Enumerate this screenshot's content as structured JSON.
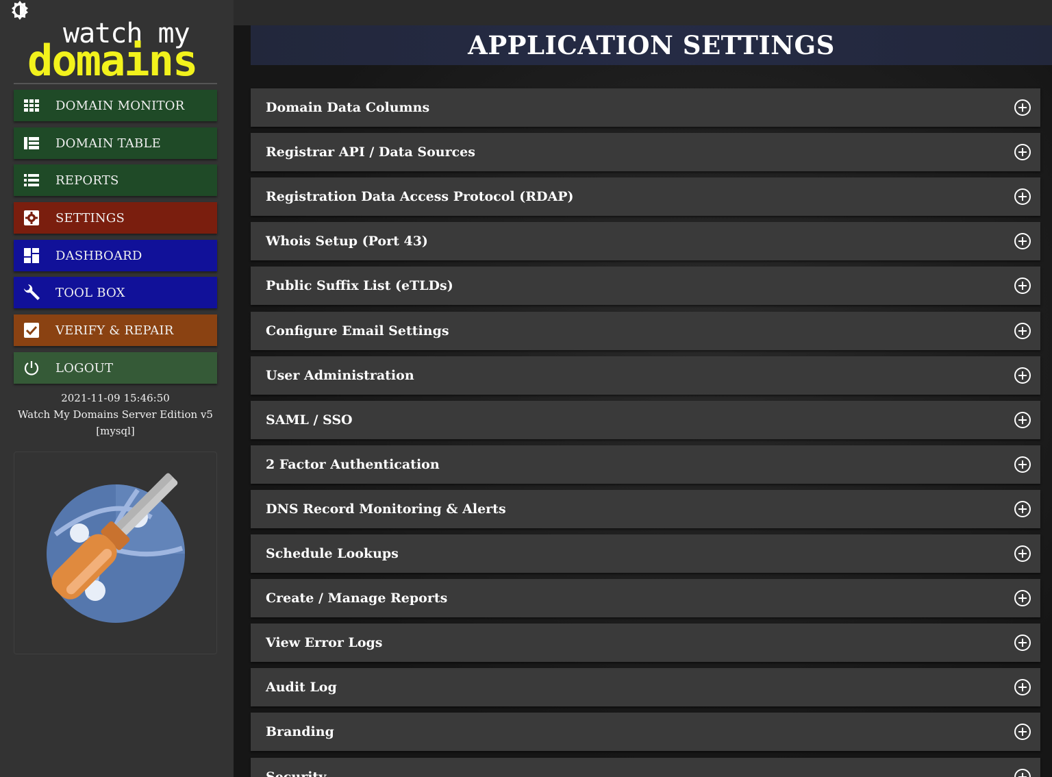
{
  "app": {
    "logo_top": "watch my",
    "logo_bottom": "domains",
    "theme_toggle_icon": "brightness-icon"
  },
  "sidebar": {
    "items": [
      {
        "label": "DOMAIN MONITOR",
        "icon": "grid-icon",
        "color": "#1f4a27"
      },
      {
        "label": "DOMAIN TABLE",
        "icon": "table-icon",
        "color": "#1f4a27"
      },
      {
        "label": "REPORTS",
        "icon": "list-icon",
        "color": "#1f4a27"
      },
      {
        "label": "SETTINGS",
        "icon": "gear-icon",
        "color": "#7a1e0e",
        "active": true
      },
      {
        "label": "DASHBOARD",
        "icon": "dashboard-icon",
        "color": "#111199"
      },
      {
        "label": "TOOL BOX",
        "icon": "wrench-icon",
        "color": "#111199"
      },
      {
        "label": "VERIFY & REPAIR",
        "icon": "checkbox-icon",
        "color": "#8a4212"
      },
      {
        "label": "LOGOUT",
        "icon": "power-icon",
        "color": "#355a37"
      }
    ],
    "info": {
      "datetime": "2021-11-09 15:46:50",
      "edition": "Watch My Domains Server Edition v5",
      "db": "[mysql]"
    }
  },
  "main": {
    "title": "APPLICATION SETTINGS",
    "panels": [
      {
        "label": "Domain Data Columns"
      },
      {
        "label": "Registrar API / Data Sources"
      },
      {
        "label": "Registration Data Access Protocol (RDAP)"
      },
      {
        "label": "Whois Setup (Port 43)"
      },
      {
        "label": "Public Suffix List (eTLDs)"
      },
      {
        "label": "Configure Email Settings"
      },
      {
        "label": "User Administration"
      },
      {
        "label": "SAML / SSO"
      },
      {
        "label": "2 Factor Authentication"
      },
      {
        "label": "DNS Record Monitoring & Alerts"
      },
      {
        "label": "Schedule Lookups"
      },
      {
        "label": "Create / Manage Reports"
      },
      {
        "label": "View Error Logs"
      },
      {
        "label": "Audit Log"
      },
      {
        "label": "Branding"
      },
      {
        "label": "Security"
      }
    ],
    "expand_icon": "plus-circle-icon"
  },
  "colors": {
    "sidebar_bg": "#333333",
    "panel_bg": "#3a3a3a",
    "header_bg": "#252b45",
    "logo_accent": "#f2f21c"
  }
}
